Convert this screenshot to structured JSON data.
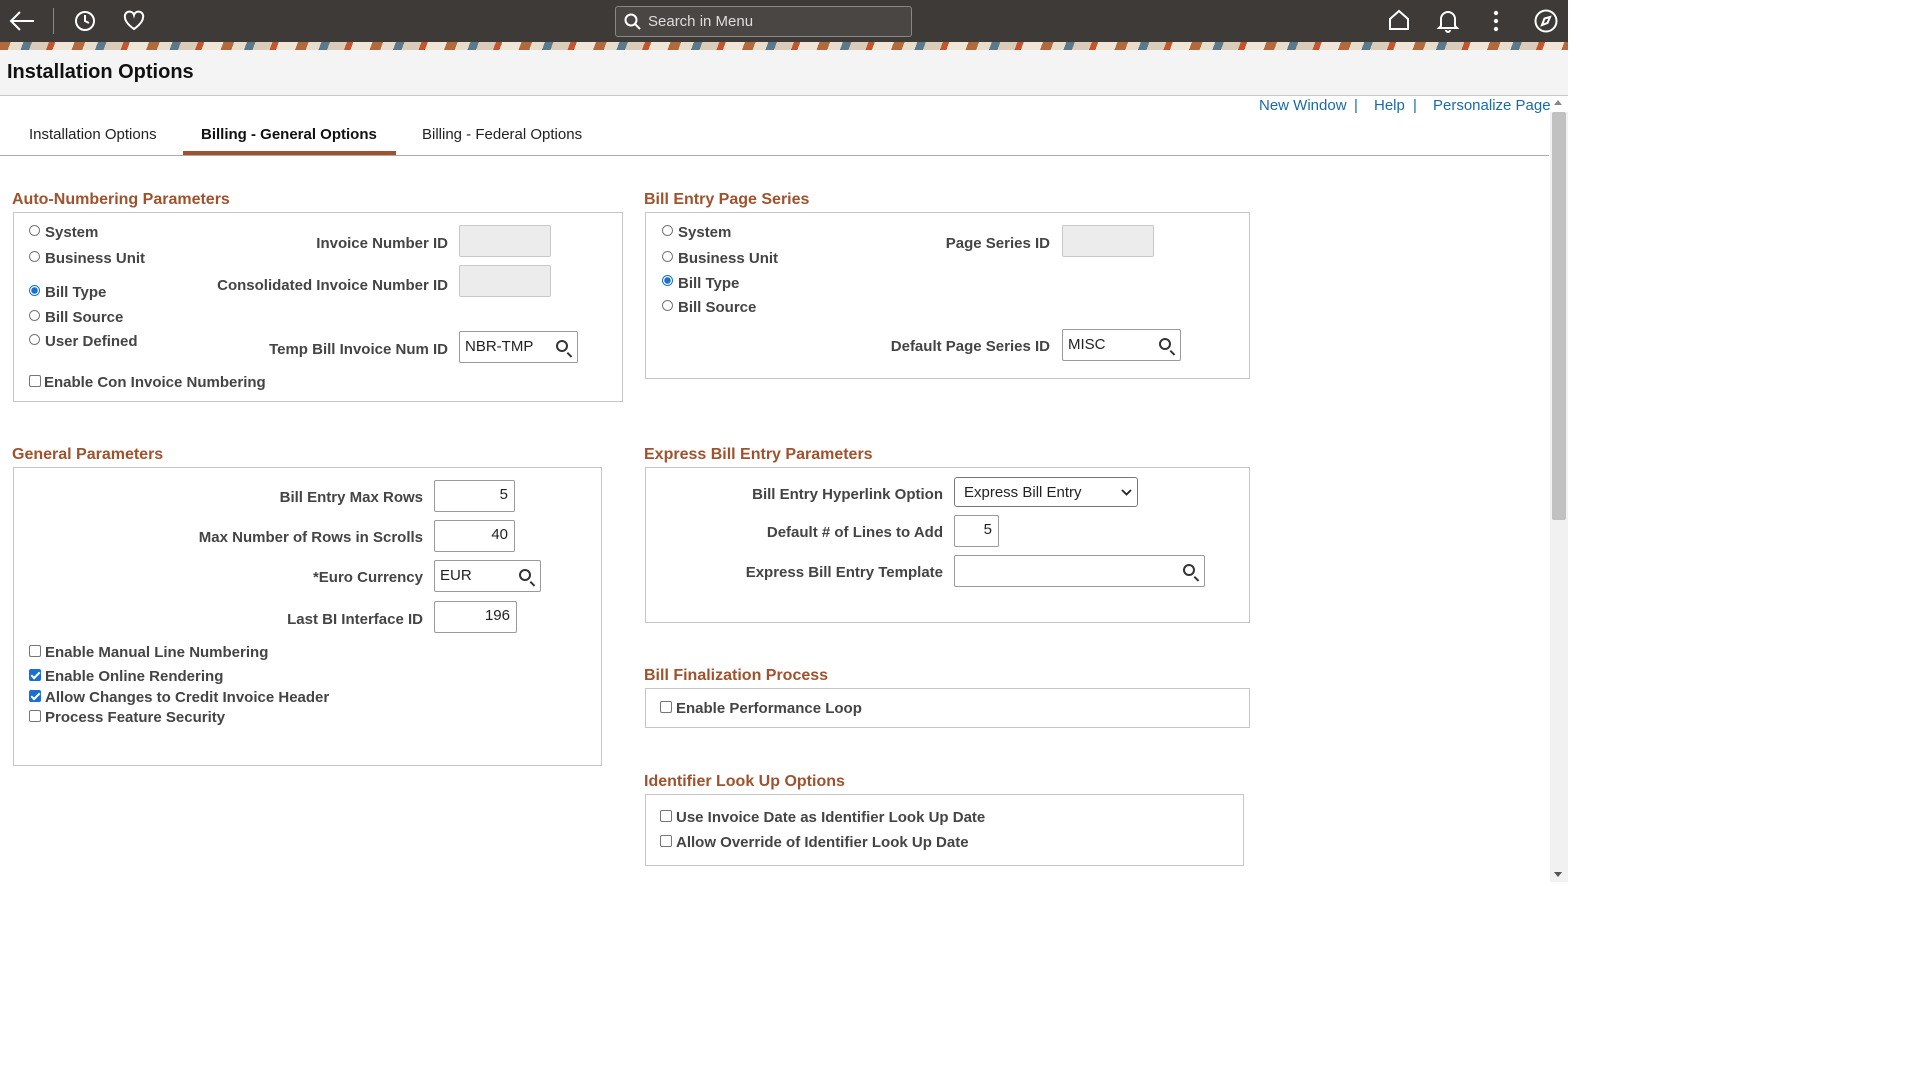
{
  "header": {
    "search_placeholder": "Search in Menu",
    "page_title": "Installation Options"
  },
  "links": {
    "new_window": "New Window",
    "help": "Help",
    "personalize": "Personalize Page",
    "separator": "|"
  },
  "tabs": [
    {
      "label": "Installation Options",
      "active": false
    },
    {
      "label": "Billing - General Options",
      "active": true
    },
    {
      "label": "Billing - Federal Options",
      "active": false
    }
  ],
  "auto_numbering": {
    "title": "Auto-Numbering Parameters",
    "options": [
      {
        "label": "System",
        "selected": false
      },
      {
        "label": "Business Unit",
        "selected": false
      },
      {
        "label": "Bill Type",
        "selected": true
      },
      {
        "label": "Bill Source",
        "selected": false
      },
      {
        "label": "User Defined",
        "selected": false
      }
    ],
    "invoice_number_id_label": "Invoice Number ID",
    "consolidated_invoice_label": "Consolidated Invoice Number ID",
    "temp_bill_label": "Temp Bill Invoice Num ID",
    "temp_bill_value": "NBR-TMP",
    "enable_con_label": "Enable Con Invoice Numbering",
    "enable_con_checked": false
  },
  "bill_entry_series": {
    "title": "Bill Entry Page Series",
    "options": [
      {
        "label": "System",
        "selected": false
      },
      {
        "label": "Business Unit",
        "selected": false
      },
      {
        "label": "Bill Type",
        "selected": true
      },
      {
        "label": "Bill Source",
        "selected": false
      }
    ],
    "page_series_label": "Page Series ID",
    "default_series_label": "Default Page Series ID",
    "default_series_value": "MISC"
  },
  "general": {
    "title": "General Parameters",
    "max_rows_label": "Bill Entry Max Rows",
    "max_rows_value": "5",
    "scroll_rows_label": "Max Number of Rows in Scrolls",
    "scroll_rows_value": "40",
    "euro_label": "*Euro Currency",
    "euro_value": "EUR",
    "last_bi_label": "Last BI Interface ID",
    "last_bi_value": "196",
    "checks": [
      {
        "label": "Enable Manual Line Numbering",
        "checked": false
      },
      {
        "label": "Enable Online Rendering",
        "checked": true
      },
      {
        "label": "Allow Changes to Credit Invoice Header",
        "checked": true
      },
      {
        "label": "Process Feature Security",
        "checked": false
      }
    ]
  },
  "express": {
    "title": "Express Bill Entry Parameters",
    "hyperlink_label": "Bill Entry Hyperlink Option",
    "hyperlink_value": "Express Bill Entry",
    "lines_label": "Default # of Lines to Add",
    "lines_value": "5",
    "template_label": "Express Bill Entry Template",
    "template_value": ""
  },
  "finalization": {
    "title": "Bill Finalization Process",
    "perf_label": "Enable Performance Loop",
    "perf_checked": false
  },
  "identifier": {
    "title": "Identifier Look Up Options",
    "checks": [
      {
        "label": "Use Invoice Date as Identifier Look Up Date",
        "checked": false
      },
      {
        "label": "Allow Override of Identifier Look Up Date",
        "checked": false
      }
    ]
  },
  "colors": {
    "accent": "#a0522d",
    "link": "#1a6aa8",
    "topbar": "#3d3a37",
    "control": "#1a6fd1"
  },
  "icons": [
    "back-arrow-icon",
    "history-icon",
    "favorites-icon",
    "search-icon",
    "home-icon",
    "notification-icon",
    "actions-menu-icon",
    "navbar-icon",
    "lookup-icon",
    "dropdown-chevron-icon"
  ]
}
